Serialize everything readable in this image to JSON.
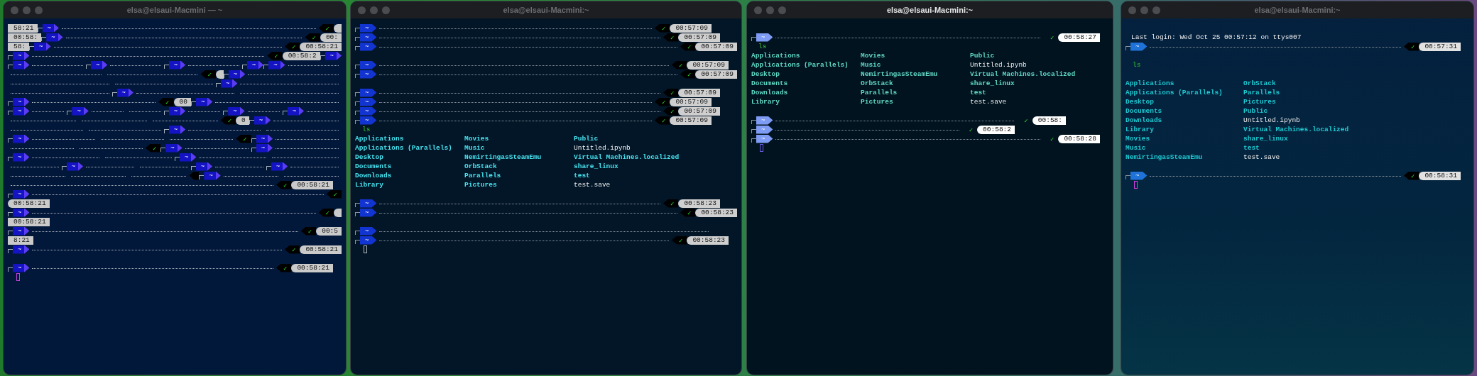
{
  "windows": [
    {
      "title": "elsa@elsaui-Macmini — ~",
      "active": false,
      "rows": [
        {
          "kind": "prompt",
          "pieces": [
            {
              "kind": "time-box",
              "text": "58:21"
            },
            {
              "kind": "dir",
              "text": "~"
            },
            {
              "kind": "dots"
            },
            {
              "kind": "status",
              "text": "✓"
            },
            {
              "kind": "cap"
            }
          ]
        },
        {
          "kind": "prompt",
          "pieces": [
            {
              "kind": "time-box",
              "text": "00:58:"
            },
            {
              "kind": "dir",
              "text": "~"
            },
            {
              "kind": "dots"
            },
            {
              "kind": "status",
              "text": "✓"
            },
            {
              "kind": "time",
              "text": "00:"
            }
          ]
        },
        {
          "kind": "prompt",
          "pieces": [
            {
              "kind": "time-box",
              "text": "58:"
            },
            {
              "kind": "dir",
              "text": "~"
            },
            {
              "kind": "dots"
            },
            {
              "kind": "status",
              "text": "✓"
            },
            {
              "kind": "time",
              "text": "00:58:21"
            }
          ]
        },
        {
          "kind": "prompt",
          "pieces": [
            {
              "kind": "dir",
              "text": "~"
            },
            {
              "kind": "dots"
            },
            {
              "kind": "status",
              "text": "✓"
            },
            {
              "kind": "time",
              "text": "00:58:2"
            },
            {
              "kind": "dir",
              "text": "~"
            }
          ]
        },
        {
          "kind": "prompt",
          "pieces": [
            {
              "kind": "dir",
              "text": "~"
            },
            {
              "kind": "dots"
            },
            {
              "kind": "dir",
              "text": "~"
            },
            {
              "kind": "dots"
            },
            {
              "kind": "dir",
              "text": "~"
            },
            {
              "kind": "dots"
            },
            {
              "kind": "dir",
              "text": "~"
            },
            {
              "kind": "dir",
              "text": "~"
            },
            {
              "kind": "dots"
            }
          ]
        },
        {
          "kind": "prompt",
          "pieces": [
            {
              "kind": "dots"
            },
            {
              "kind": "dots"
            },
            {
              "kind": "status",
              "text": "✓"
            },
            {
              "kind": "cap"
            },
            {
              "kind": "dir",
              "text": "~"
            },
            {
              "kind": "dots"
            }
          ]
        },
        {
          "kind": "prompt",
          "pieces": [
            {
              "kind": "dots"
            },
            {
              "kind": "dots"
            },
            {
              "kind": "dir",
              "text": "~"
            },
            {
              "kind": "dots"
            }
          ]
        },
        {
          "kind": "prompt",
          "pieces": [
            {
              "kind": "dots"
            },
            {
              "kind": "dir",
              "text": "~"
            },
            {
              "kind": "dots"
            },
            {
              "kind": "dots"
            }
          ]
        },
        {
          "kind": "prompt",
          "pieces": [
            {
              "kind": "dir",
              "text": "~"
            },
            {
              "kind": "dots"
            },
            {
              "kind": "status",
              "text": "✓"
            },
            {
              "kind": "time",
              "text": "00"
            },
            {
              "kind": "dir",
              "text": "~"
            },
            {
              "kind": "dots"
            }
          ]
        },
        {
          "kind": "prompt",
          "pieces": [
            {
              "kind": "dir",
              "text": "~"
            },
            {
              "kind": "dots"
            },
            {
              "kind": "dir",
              "text": "~"
            },
            {
              "kind": "dots"
            },
            {
              "kind": "dots"
            },
            {
              "kind": "dir",
              "text": "~"
            },
            {
              "kind": "dots"
            },
            {
              "kind": "dir",
              "text": "~"
            },
            {
              "kind": "dots"
            },
            {
              "kind": "dir",
              "text": "~"
            },
            {
              "kind": "dots"
            }
          ]
        },
        {
          "kind": "prompt",
          "pieces": [
            {
              "kind": "dots"
            },
            {
              "kind": "dots"
            },
            {
              "kind": "dots"
            },
            {
              "kind": "status",
              "text": "✓"
            },
            {
              "kind": "time",
              "text": "0"
            },
            {
              "kind": "dir",
              "text": "~"
            },
            {
              "kind": "dots"
            }
          ]
        },
        {
          "kind": "prompt",
          "pieces": [
            {
              "kind": "dots"
            },
            {
              "kind": "dots"
            },
            {
              "kind": "dir",
              "text": "~"
            },
            {
              "kind": "dots"
            },
            {
              "kind": "dots"
            }
          ]
        },
        {
          "kind": "prompt",
          "pieces": [
            {
              "kind": "dir",
              "text": "~"
            },
            {
              "kind": "dots"
            },
            {
              "kind": "dots"
            },
            {
              "kind": "dots"
            },
            {
              "kind": "status",
              "text": "✓"
            },
            {
              "kind": "dir",
              "text": "~"
            },
            {
              "kind": "dots"
            }
          ]
        },
        {
          "kind": "prompt",
          "pieces": [
            {
              "kind": "dots"
            },
            {
              "kind": "dots"
            },
            {
              "kind": "status",
              "text": "✓"
            },
            {
              "kind": "dir",
              "text": "~"
            },
            {
              "kind": "dots"
            },
            {
              "kind": "dir",
              "text": "~"
            },
            {
              "kind": "dots"
            }
          ]
        },
        {
          "kind": "prompt",
          "pieces": [
            {
              "kind": "dir",
              "text": "~"
            },
            {
              "kind": "dots"
            },
            {
              "kind": "dots"
            },
            {
              "kind": "dir",
              "text": "~"
            },
            {
              "kind": "dots"
            },
            {
              "kind": "dots"
            }
          ]
        },
        {
          "kind": "prompt",
          "pieces": [
            {
              "kind": "dots"
            },
            {
              "kind": "dir",
              "text": "~"
            },
            {
              "kind": "dots"
            },
            {
              "kind": "dots"
            },
            {
              "kind": "dir",
              "text": "~"
            },
            {
              "kind": "dots"
            },
            {
              "kind": "dir",
              "text": "~"
            },
            {
              "kind": "dots"
            }
          ]
        },
        {
          "kind": "prompt",
          "pieces": [
            {
              "kind": "dots"
            },
            {
              "kind": "dots"
            },
            {
              "kind": "dots"
            },
            {
              "kind": "status-cap"
            },
            {
              "kind": "dir",
              "text": "~"
            },
            {
              "kind": "dots"
            },
            {
              "kind": "dots"
            }
          ]
        },
        {
          "kind": "prompt",
          "pieces": [
            {
              "kind": "dots"
            },
            {
              "kind": "status",
              "text": "✓"
            },
            {
              "kind": "time",
              "text": "00:58:21"
            },
            {
              "kind": "gap"
            }
          ]
        },
        {
          "kind": "prompt",
          "pieces": [
            {
              "kind": "dir",
              "text": "~"
            },
            {
              "kind": "dots"
            },
            {
              "kind": "status",
              "text": "✓"
            }
          ]
        },
        {
          "kind": "prompt",
          "pieces": [
            {
              "kind": "time",
              "text": "00:58:21"
            },
            {
              "kind": "gap"
            }
          ]
        },
        {
          "kind": "prompt",
          "pieces": [
            {
              "kind": "dir",
              "text": "~"
            },
            {
              "kind": "dots"
            },
            {
              "kind": "status",
              "text": "✓"
            },
            {
              "kind": "cap"
            }
          ]
        },
        {
          "kind": "prompt",
          "pieces": [
            {
              "kind": "time-box",
              "text": "00:58:21"
            },
            {
              "kind": "gap"
            }
          ]
        },
        {
          "kind": "prompt",
          "pieces": [
            {
              "kind": "dir",
              "text": "~"
            },
            {
              "kind": "dots"
            },
            {
              "kind": "status",
              "text": "✓"
            },
            {
              "kind": "time",
              "text": "00:5"
            }
          ]
        },
        {
          "kind": "prompt",
          "pieces": [
            {
              "kind": "time-box",
              "text": "8:21"
            },
            {
              "kind": "gap"
            }
          ]
        },
        {
          "kind": "prompt",
          "pieces": [
            {
              "kind": "dir",
              "text": "~"
            },
            {
              "kind": "dots"
            },
            {
              "kind": "status",
              "text": "✓"
            },
            {
              "kind": "time",
              "text": "00:58:21"
            }
          ]
        },
        {
          "kind": "blank"
        },
        {
          "kind": "prompt",
          "pieces": [
            {
              "kind": "dir",
              "text": "~"
            },
            {
              "kind": "dots"
            },
            {
              "kind": "status",
              "text": "✓"
            },
            {
              "kind": "time",
              "text": "00:58:21"
            },
            {
              "kind": "gap"
            }
          ]
        },
        {
          "kind": "cursor"
        }
      ]
    },
    {
      "title": "elsa@elsaui-Macmini:~",
      "active": false,
      "rows": [
        {
          "kind": "prompt",
          "pieces": [
            {
              "kind": "dir",
              "text": "~"
            },
            {
              "kind": "dots"
            },
            {
              "kind": "status",
              "text": "✓"
            },
            {
              "kind": "time",
              "text": "00:57:09"
            },
            {
              "kind": "gap"
            },
            {
              "kind": "gap"
            },
            {
              "kind": "gap"
            }
          ]
        },
        {
          "kind": "prompt",
          "pieces": [
            {
              "kind": "dir",
              "text": "~"
            },
            {
              "kind": "dots"
            },
            {
              "kind": "status",
              "text": "✓"
            },
            {
              "kind": "time",
              "text": "00:57:09"
            },
            {
              "kind": "gap"
            },
            {
              "kind": "gap"
            }
          ]
        },
        {
          "kind": "prompt",
          "pieces": [
            {
              "kind": "dir",
              "text": "~"
            },
            {
              "kind": "dots"
            },
            {
              "kind": "status",
              "text": "✓"
            },
            {
              "kind": "time",
              "text": "00:57:09"
            }
          ]
        },
        {
          "kind": "blank"
        },
        {
          "kind": "prompt",
          "pieces": [
            {
              "kind": "dir",
              "text": "~"
            },
            {
              "kind": "dots"
            },
            {
              "kind": "status",
              "text": "✓"
            },
            {
              "kind": "time",
              "text": "00:57:09"
            },
            {
              "kind": "gap"
            }
          ]
        },
        {
          "kind": "prompt",
          "pieces": [
            {
              "kind": "dir",
              "text": "~"
            },
            {
              "kind": "dots"
            },
            {
              "kind": "status",
              "text": "✓"
            },
            {
              "kind": "time",
              "text": "00:57:09"
            }
          ]
        },
        {
          "kind": "blank"
        },
        {
          "kind": "prompt",
          "pieces": [
            {
              "kind": "dir",
              "text": "~"
            },
            {
              "kind": "dots"
            },
            {
              "kind": "status",
              "text": "✓"
            },
            {
              "kind": "time",
              "text": "00:57:09"
            },
            {
              "kind": "gap"
            },
            {
              "kind": "gap"
            }
          ]
        },
        {
          "kind": "prompt",
          "pieces": [
            {
              "kind": "dir",
              "text": "~"
            },
            {
              "kind": "dots"
            },
            {
              "kind": "status",
              "text": "✓"
            },
            {
              "kind": "time",
              "text": "00:57:09"
            },
            {
              "kind": "gap"
            },
            {
              "kind": "gap"
            },
            {
              "kind": "gap"
            }
          ]
        },
        {
          "kind": "prompt",
          "pieces": [
            {
              "kind": "dir",
              "text": "~"
            },
            {
              "kind": "dots"
            },
            {
              "kind": "status",
              "text": "✓"
            },
            {
              "kind": "time",
              "text": "00:57:09"
            },
            {
              "kind": "gap"
            },
            {
              "kind": "gap"
            }
          ]
        },
        {
          "kind": "prompt",
          "pieces": [
            {
              "kind": "dir",
              "text": "~"
            },
            {
              "kind": "dots"
            },
            {
              "kind": "status",
              "text": "✓"
            },
            {
              "kind": "time",
              "text": "00:57:09"
            },
            {
              "kind": "gap"
            },
            {
              "kind": "gap"
            },
            {
              "kind": "gap"
            }
          ]
        },
        {
          "kind": "command",
          "text": "ls"
        },
        {
          "kind": "listing",
          "columns": [
            [
              {
                "kind": "dir",
                "text": "Applications"
              },
              {
                "kind": "dir",
                "text": "Applications (Parallels)"
              },
              {
                "kind": "dir",
                "text": "Desktop"
              },
              {
                "kind": "dir",
                "text": "Documents"
              },
              {
                "kind": "dir",
                "text": "Downloads"
              },
              {
                "kind": "dir",
                "text": "Library"
              }
            ],
            [
              {
                "kind": "dir",
                "text": "Movies"
              },
              {
                "kind": "dir",
                "text": "Music"
              },
              {
                "kind": "dir",
                "text": "NemirtingasSteamEmu"
              },
              {
                "kind": "dir",
                "text": "OrbStack"
              },
              {
                "kind": "dir",
                "text": "Parallels"
              },
              {
                "kind": "dir",
                "text": "Pictures"
              }
            ],
            [
              {
                "kind": "dir",
                "text": "Public"
              },
              {
                "kind": "file",
                "text": "Untitled.ipynb"
              },
              {
                "kind": "dir",
                "text": "Virtual Machines.localized"
              },
              {
                "kind": "dir",
                "text": "share_linux"
              },
              {
                "kind": "dir",
                "text": "test"
              },
              {
                "kind": "file",
                "text": "test.save"
              }
            ]
          ]
        },
        {
          "kind": "blank"
        },
        {
          "kind": "prompt",
          "pieces": [
            {
              "kind": "dir",
              "text": "~"
            },
            {
              "kind": "dots"
            },
            {
              "kind": "status",
              "text": "✓"
            },
            {
              "kind": "time",
              "text": "00:58:23"
            },
            {
              "kind": "gap"
            },
            {
              "kind": "gap"
            }
          ]
        },
        {
          "kind": "prompt",
          "pieces": [
            {
              "kind": "dir",
              "text": "~"
            },
            {
              "kind": "dots"
            },
            {
              "kind": "status",
              "text": "✓"
            },
            {
              "kind": "time",
              "text": "00:58:23"
            }
          ]
        },
        {
          "kind": "blank"
        },
        {
          "kind": "prompt",
          "pieces": [
            {
              "kind": "dir",
              "text": "~"
            },
            {
              "kind": "dots"
            },
            {
              "kind": "gap"
            },
            {
              "kind": "gap"
            },
            {
              "kind": "gap"
            }
          ]
        },
        {
          "kind": "prompt",
          "pieces": [
            {
              "kind": "dir",
              "text": "~"
            },
            {
              "kind": "dots"
            },
            {
              "kind": "status",
              "text": "✓"
            },
            {
              "kind": "time",
              "text": "00:58:23"
            },
            {
              "kind": "gap"
            }
          ]
        },
        {
          "kind": "cursor"
        }
      ]
    },
    {
      "title": "elsa@elsaui-Macmini:~",
      "active": true,
      "rows": [
        {
          "kind": "blank"
        },
        {
          "kind": "prompt",
          "pieces": [
            {
              "kind": "dir",
              "text": "~"
            },
            {
              "kind": "dots"
            },
            {
              "kind": "status",
              "text": "✓"
            },
            {
              "kind": "time",
              "text": "00:58:27"
            },
            {
              "kind": "gap"
            }
          ]
        },
        {
          "kind": "command",
          "text": "ls"
        },
        {
          "kind": "listing",
          "columns": [
            [
              {
                "kind": "dir",
                "text": "Applications"
              },
              {
                "kind": "dir",
                "text": "Applications (Parallels)"
              },
              {
                "kind": "dir",
                "text": "Desktop"
              },
              {
                "kind": "dir",
                "text": "Documents"
              },
              {
                "kind": "dir",
                "text": "Downloads"
              },
              {
                "kind": "dir",
                "text": "Library"
              }
            ],
            [
              {
                "kind": "dir",
                "text": "Movies"
              },
              {
                "kind": "dir",
                "text": "Music"
              },
              {
                "kind": "dir",
                "text": "NemirtingasSteamEmu"
              },
              {
                "kind": "dir",
                "text": "OrbStack"
              },
              {
                "kind": "dir",
                "text": "Parallels"
              },
              {
                "kind": "dir",
                "text": "Pictures"
              }
            ],
            [
              {
                "kind": "dir",
                "text": "Public"
              },
              {
                "kind": "file",
                "text": "Untitled.ipynb"
              },
              {
                "kind": "dir",
                "text": "Virtual Machines.localized"
              },
              {
                "kind": "dir",
                "text": "share_linux"
              },
              {
                "kind": "dir",
                "text": "test"
              },
              {
                "kind": "file",
                "text": "test.save"
              }
            ]
          ]
        },
        {
          "kind": "blank"
        },
        {
          "kind": "prompt",
          "pieces": [
            {
              "kind": "dir",
              "text": "~"
            },
            {
              "kind": "dots"
            },
            {
              "kind": "status",
              "text": "✓"
            },
            {
              "kind": "time",
              "text": "00:58:"
            },
            {
              "kind": "gap"
            },
            {
              "kind": "gap"
            },
            {
              "kind": "gap"
            },
            {
              "kind": "gap"
            },
            {
              "kind": "gap"
            }
          ]
        },
        {
          "kind": "prompt",
          "pieces": [
            {
              "kind": "dir",
              "text": "~"
            },
            {
              "kind": "dots"
            },
            {
              "kind": "status",
              "text": "✓"
            },
            {
              "kind": "time",
              "text": "00:58:2"
            },
            {
              "kind": "gap"
            },
            {
              "kind": "gap"
            },
            {
              "kind": "gap"
            },
            {
              "kind": "gap"
            },
            {
              "kind": "gap"
            },
            {
              "kind": "gap"
            },
            {
              "kind": "gap"
            },
            {
              "kind": "gap"
            },
            {
              "kind": "gap"
            },
            {
              "kind": "gap"
            },
            {
              "kind": "gap"
            }
          ]
        },
        {
          "kind": "prompt",
          "pieces": [
            {
              "kind": "dir",
              "text": "~"
            },
            {
              "kind": "dots"
            },
            {
              "kind": "status",
              "text": "✓"
            },
            {
              "kind": "time",
              "text": "00:58:28"
            },
            {
              "kind": "gap"
            }
          ]
        },
        {
          "kind": "cursor"
        }
      ]
    },
    {
      "title": "elsa@elsaui-Macmini:~",
      "active": false,
      "rows": [
        {
          "kind": "blank"
        },
        {
          "kind": "text",
          "text": "Last login: Wed Oct 25 00:57:12 on ttys007"
        },
        {
          "kind": "prompt",
          "pieces": [
            {
              "kind": "dir",
              "text": "~"
            },
            {
              "kind": "dots"
            },
            {
              "kind": "status",
              "text": "✓"
            },
            {
              "kind": "time",
              "text": "00:57:31"
            },
            {
              "kind": "gap"
            }
          ]
        },
        {
          "kind": "blank"
        },
        {
          "kind": "command",
          "text": "ls"
        },
        {
          "kind": "blank"
        },
        {
          "kind": "listing",
          "columns": [
            [
              {
                "kind": "dir",
                "text": "Applications"
              },
              {
                "kind": "dir",
                "text": "Applications (Parallels)"
              },
              {
                "kind": "dir",
                "text": "Desktop"
              },
              {
                "kind": "dir",
                "text": "Documents"
              },
              {
                "kind": "dir",
                "text": "Downloads"
              },
              {
                "kind": "dir",
                "text": "Library"
              },
              {
                "kind": "dir",
                "text": "Movies"
              },
              {
                "kind": "dir",
                "text": "Music"
              },
              {
                "kind": "dir",
                "text": "NemirtingasSteamEmu"
              }
            ],
            [
              {
                "kind": "dir",
                "text": "OrbStack"
              },
              {
                "kind": "dir",
                "text": "Parallels"
              },
              {
                "kind": "dir",
                "text": "Pictures"
              },
              {
                "kind": "dir",
                "text": "Public"
              },
              {
                "kind": "file",
                "text": "Untitled.ipynb"
              },
              {
                "kind": "dir",
                "text": "Virtual Machines.localized"
              },
              {
                "kind": "dir",
                "text": "share_linux"
              },
              {
                "kind": "dir",
                "text": "test"
              },
              {
                "kind": "file",
                "text": "test.save"
              }
            ]
          ]
        },
        {
          "kind": "blank"
        },
        {
          "kind": "prompt",
          "pieces": [
            {
              "kind": "dir",
              "text": "~"
            },
            {
              "kind": "dots"
            },
            {
              "kind": "status",
              "text": "✓"
            },
            {
              "kind": "time",
              "text": "00:58:31"
            },
            {
              "kind": "gap"
            }
          ]
        },
        {
          "kind": "cursor"
        }
      ]
    }
  ]
}
